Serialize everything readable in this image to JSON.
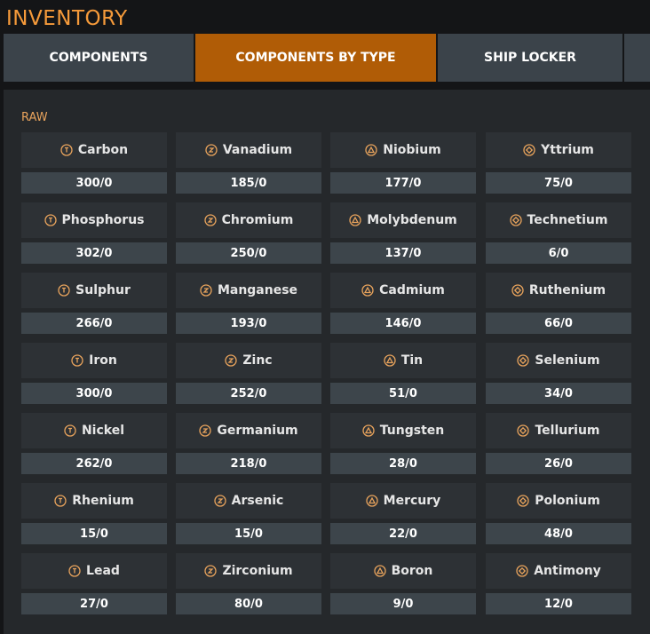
{
  "header": {
    "title": "INVENTORY"
  },
  "tabs": [
    {
      "label": "COMPONENTS",
      "active": false
    },
    {
      "label": "COMPONENTS BY TYPE",
      "active": true
    },
    {
      "label": "SHIP LOCKER",
      "active": false
    }
  ],
  "section": {
    "label": "RAW"
  },
  "colors": {
    "accent": "#f59a3a",
    "active_tab": "#b05c06",
    "icon": "#e8a35c"
  },
  "materials": [
    [
      {
        "name": "Carbon",
        "count": "300/0",
        "grade": 1,
        "icon": "grade-1-icon"
      },
      {
        "name": "Vanadium",
        "count": "185/0",
        "grade": 2,
        "icon": "grade-2-icon"
      },
      {
        "name": "Niobium",
        "count": "177/0",
        "grade": 3,
        "icon": "grade-3-icon"
      },
      {
        "name": "Yttrium",
        "count": "75/0",
        "grade": 4,
        "icon": "grade-4-icon"
      }
    ],
    [
      {
        "name": "Phosphorus",
        "count": "302/0",
        "grade": 1,
        "icon": "grade-1-icon"
      },
      {
        "name": "Chromium",
        "count": "250/0",
        "grade": 2,
        "icon": "grade-2-icon"
      },
      {
        "name": "Molybdenum",
        "count": "137/0",
        "grade": 3,
        "icon": "grade-3-icon"
      },
      {
        "name": "Technetium",
        "count": "6/0",
        "grade": 4,
        "icon": "grade-4-icon"
      }
    ],
    [
      {
        "name": "Sulphur",
        "count": "266/0",
        "grade": 1,
        "icon": "grade-1-icon"
      },
      {
        "name": "Manganese",
        "count": "193/0",
        "grade": 2,
        "icon": "grade-2-icon"
      },
      {
        "name": "Cadmium",
        "count": "146/0",
        "grade": 3,
        "icon": "grade-3-icon"
      },
      {
        "name": "Ruthenium",
        "count": "66/0",
        "grade": 4,
        "icon": "grade-4-icon"
      }
    ],
    [
      {
        "name": "Iron",
        "count": "300/0",
        "grade": 1,
        "icon": "grade-1-icon"
      },
      {
        "name": "Zinc",
        "count": "252/0",
        "grade": 2,
        "icon": "grade-2-icon"
      },
      {
        "name": "Tin",
        "count": "51/0",
        "grade": 3,
        "icon": "grade-3-icon"
      },
      {
        "name": "Selenium",
        "count": "34/0",
        "grade": 4,
        "icon": "grade-4-icon"
      }
    ],
    [
      {
        "name": "Nickel",
        "count": "262/0",
        "grade": 1,
        "icon": "grade-1-icon"
      },
      {
        "name": "Germanium",
        "count": "218/0",
        "grade": 2,
        "icon": "grade-2-icon"
      },
      {
        "name": "Tungsten",
        "count": "28/0",
        "grade": 3,
        "icon": "grade-3-icon"
      },
      {
        "name": "Tellurium",
        "count": "26/0",
        "grade": 4,
        "icon": "grade-4-icon"
      }
    ],
    [
      {
        "name": "Rhenium",
        "count": "15/0",
        "grade": 1,
        "icon": "grade-1-icon"
      },
      {
        "name": "Arsenic",
        "count": "15/0",
        "grade": 2,
        "icon": "grade-2-icon"
      },
      {
        "name": "Mercury",
        "count": "22/0",
        "grade": 3,
        "icon": "grade-3-icon"
      },
      {
        "name": "Polonium",
        "count": "48/0",
        "grade": 4,
        "icon": "grade-4-icon"
      }
    ],
    [
      {
        "name": "Lead",
        "count": "27/0",
        "grade": 1,
        "icon": "grade-1-icon"
      },
      {
        "name": "Zirconium",
        "count": "80/0",
        "grade": 2,
        "icon": "grade-2-icon"
      },
      {
        "name": "Boron",
        "count": "9/0",
        "grade": 3,
        "icon": "grade-3-icon"
      },
      {
        "name": "Antimony",
        "count": "12/0",
        "grade": 4,
        "icon": "grade-4-icon"
      }
    ]
  ]
}
